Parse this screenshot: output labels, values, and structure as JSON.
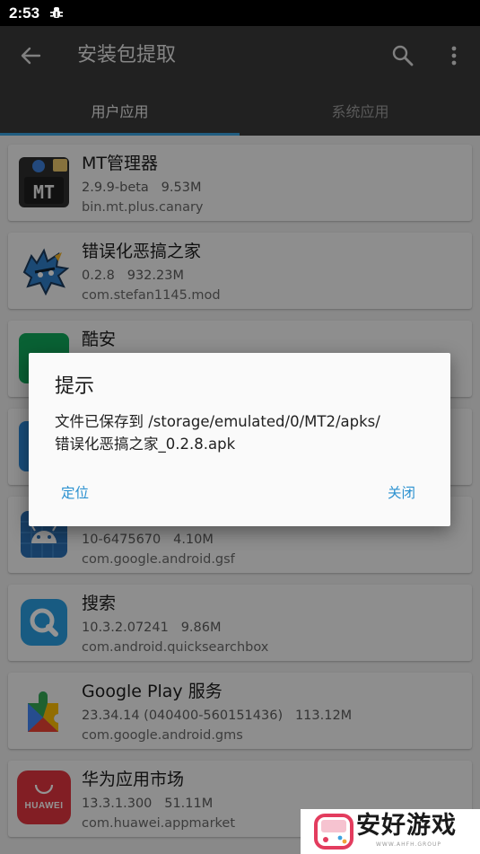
{
  "status_bar": {
    "time": "2:53",
    "notification_icon": "bug-icon"
  },
  "app_bar": {
    "title": "安装包提取",
    "back_icon": "arrow-back-icon",
    "search_icon": "search-icon",
    "more_icon": "more-vert-icon",
    "tabs": [
      {
        "label": "用户应用",
        "selected": true
      },
      {
        "label": "系统应用",
        "selected": false
      }
    ],
    "accent_color": "#39a0dc"
  },
  "apps": [
    {
      "name": "MT管理器",
      "version": "2.9.9-beta",
      "size": "9.53M",
      "package": "bin.mt.plus.canary",
      "icon": "mt-manager-icon"
    },
    {
      "name": "错误化恶搞之家",
      "version": "0.2.8",
      "size": "932.23M",
      "package": "com.stefan1145.mod",
      "icon": "fnf-mod-icon"
    },
    {
      "name": "酷安",
      "version": "",
      "size": "",
      "package": "",
      "icon": "coolapk-icon"
    },
    {
      "name": "",
      "version": "",
      "size": "",
      "package": "",
      "icon": "blue-app-icon"
    },
    {
      "name": "",
      "version": "10-6475670",
      "size": "4.10M",
      "package": "com.google.android.gsf",
      "icon": "android-services-icon"
    },
    {
      "name": "搜索",
      "version": "10.3.2.07241",
      "size": "9.86M",
      "package": "com.android.quicksearchbox",
      "icon": "quick-search-icon"
    },
    {
      "name": "Google Play 服务",
      "version": "23.34.14 (040400-560151436)",
      "size": "113.12M",
      "package": "com.google.android.gms",
      "icon": "play-services-icon"
    },
    {
      "name": "华为应用市场",
      "version": "13.3.1.300",
      "size": "51.11M",
      "package": "com.huawei.appmarket",
      "icon": "huawei-appgallery-icon",
      "icon_text": "HUAWEI"
    }
  ],
  "dialog": {
    "title": "提示",
    "message_line1": "文件已保存到 /storage/emulated/0/MT2/apks/",
    "message_line2": "错误化恶搞之家_0.2.8.apk",
    "locate_label": "定位",
    "close_label": "关闭",
    "button_color": "#2b91d0"
  },
  "watermark": {
    "text": "安好游戏",
    "subtext": "WWW.AHFH.GROUP"
  }
}
